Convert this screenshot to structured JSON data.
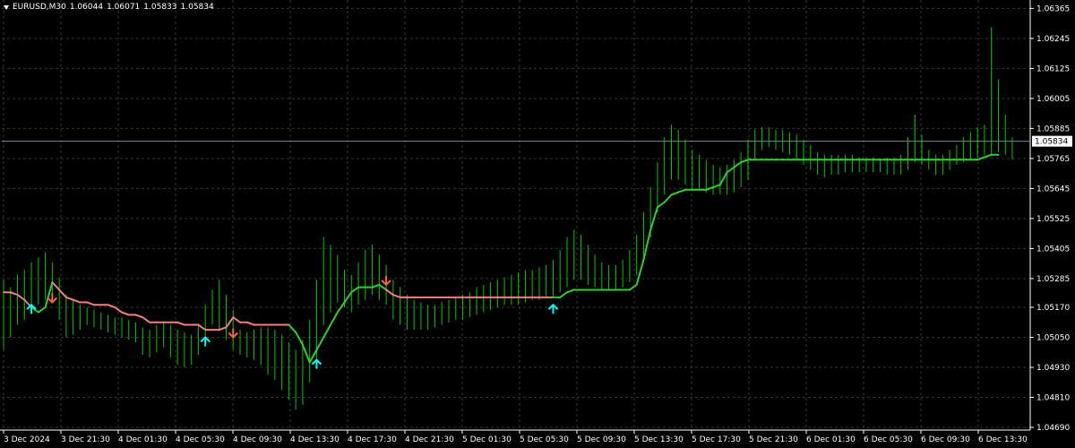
{
  "header": {
    "symbol": "EURUSD,M30",
    "open": "1.06044",
    "high": "1.06071",
    "low": "1.05833",
    "close": "1.05834"
  },
  "colors": {
    "background": "#000000",
    "grid": "#2a3b2a",
    "bars": "#00c800",
    "line_up": "#32cd32",
    "line_down": "#f08080",
    "arrow_up": "#00ffff",
    "arrow_down": "#ff6347",
    "current_price_line": "#778899",
    "axis_text": "#ffffff"
  },
  "chart_data": {
    "type": "line",
    "symbol": "EURUSD",
    "timeframe": "M30",
    "y_ticks": [
      "1.06365",
      "1.06245",
      "1.06125",
      "1.06005",
      "1.05885",
      "1.05765",
      "1.05645",
      "1.05525",
      "1.05405",
      "1.05285",
      "1.05170",
      "1.05050",
      "1.04930",
      "1.04810",
      "1.04690"
    ],
    "ylim": [
      1.0469,
      1.0637
    ],
    "x_ticks": [
      "3 Dec 2024",
      "3 Dec 21:30",
      "4 Dec 01:30",
      "4 Dec 05:30",
      "4 Dec 09:30",
      "4 Dec 13:30",
      "4 Dec 17:30",
      "4 Dec 21:30",
      "5 Dec 01:30",
      "5 Dec 05:30",
      "5 Dec 09:30",
      "5 Dec 13:30",
      "5 Dec 17:30",
      "5 Dec 21:30",
      "6 Dec 01:30",
      "6 Dec 05:30",
      "6 Dec 09:30",
      "6 Dec 13:30"
    ],
    "current_price": "1.05834",
    "bar_count": 142,
    "bars_high_low": [
      [
        1.0528,
        1.05
      ],
      [
        1.0525,
        1.0505
      ],
      [
        1.053,
        1.051
      ],
      [
        1.0532,
        1.0512
      ],
      [
        1.0535,
        1.0515
      ],
      [
        1.0537,
        1.0518
      ],
      [
        1.0539,
        1.052
      ],
      [
        1.0535,
        1.052
      ],
      [
        1.0529,
        1.0512
      ],
      [
        1.0522,
        1.0505
      ],
      [
        1.052,
        1.0506
      ],
      [
        1.0518,
        1.0508
      ],
      [
        1.0517,
        1.051
      ],
      [
        1.0516,
        1.0509
      ],
      [
        1.0515,
        1.0508
      ],
      [
        1.0514,
        1.0507
      ],
      [
        1.0513,
        1.0506
      ],
      [
        1.0513,
        1.0505
      ],
      [
        1.0512,
        1.0504
      ],
      [
        1.0511,
        1.0503
      ],
      [
        1.0509,
        1.0498
      ],
      [
        1.0508,
        1.0497
      ],
      [
        1.051,
        1.0499
      ],
      [
        1.0511,
        1.0501
      ],
      [
        1.051,
        1.0497
      ],
      [
        1.0508,
        1.0494
      ],
      [
        1.0507,
        1.0493
      ],
      [
        1.0506,
        1.0494
      ],
      [
        1.051,
        1.0498
      ],
      [
        1.0518,
        1.0504
      ],
      [
        1.0524,
        1.051
      ],
      [
        1.0528,
        1.0508
      ],
      [
        1.0522,
        1.0504
      ],
      [
        1.0516,
        1.05
      ],
      [
        1.0508,
        1.0498
      ],
      [
        1.0507,
        1.0497
      ],
      [
        1.0508,
        1.0496
      ],
      [
        1.0509,
        1.0494
      ],
      [
        1.0509,
        1.049
      ],
      [
        1.0508,
        1.0488
      ],
      [
        1.0506,
        1.0484
      ],
      [
        1.0503,
        1.048
      ],
      [
        1.05,
        1.0476
      ],
      [
        1.0504,
        1.0478
      ],
      [
        1.0512,
        1.0487
      ],
      [
        1.0528,
        1.0496
      ],
      [
        1.0545,
        1.051
      ],
      [
        1.0542,
        1.0515
      ],
      [
        1.0538,
        1.0519
      ],
      [
        1.0532,
        1.0517
      ],
      [
        1.053,
        1.0515
      ],
      [
        1.0535,
        1.0518
      ],
      [
        1.054,
        1.052
      ],
      [
        1.0542,
        1.0522
      ],
      [
        1.0538,
        1.052
      ],
      [
        1.0534,
        1.0518
      ],
      [
        1.0528,
        1.0512
      ],
      [
        1.0525,
        1.051
      ],
      [
        1.0522,
        1.0508
      ],
      [
        1.052,
        1.0508
      ],
      [
        1.0519,
        1.0508
      ],
      [
        1.0518,
        1.0508
      ],
      [
        1.0518,
        1.0509
      ],
      [
        1.0519,
        1.051
      ],
      [
        1.052,
        1.0511
      ],
      [
        1.0521,
        1.0512
      ],
      [
        1.0522,
        1.0512
      ],
      [
        1.0523,
        1.0513
      ],
      [
        1.0525,
        1.0514
      ],
      [
        1.0526,
        1.0515
      ],
      [
        1.0527,
        1.0516
      ],
      [
        1.0528,
        1.0517
      ],
      [
        1.0529,
        1.0518
      ],
      [
        1.053,
        1.0518
      ],
      [
        1.0531,
        1.0518
      ],
      [
        1.0532,
        1.0519
      ],
      [
        1.0532,
        1.052
      ],
      [
        1.0533,
        1.052
      ],
      [
        1.0534,
        1.0521
      ],
      [
        1.0536,
        1.0521
      ],
      [
        1.054,
        1.0523
      ],
      [
        1.0545,
        1.0525
      ],
      [
        1.0548,
        1.0528
      ],
      [
        1.0546,
        1.0528
      ],
      [
        1.0542,
        1.0526
      ],
      [
        1.0538,
        1.0525
      ],
      [
        1.0535,
        1.0524
      ],
      [
        1.0534,
        1.0524
      ],
      [
        1.0534,
        1.0524
      ],
      [
        1.0536,
        1.0525
      ],
      [
        1.054,
        1.0527
      ],
      [
        1.0546,
        1.053
      ],
      [
        1.0555,
        1.0535
      ],
      [
        1.0565,
        1.0545
      ],
      [
        1.0575,
        1.0555
      ],
      [
        1.0585,
        1.0562
      ],
      [
        1.059,
        1.0568
      ],
      [
        1.0588,
        1.0568
      ],
      [
        1.0584,
        1.0566
      ],
      [
        1.058,
        1.0564
      ],
      [
        1.0578,
        1.0564
      ],
      [
        1.0576,
        1.0563
      ],
      [
        1.0574,
        1.0562
      ],
      [
        1.0573,
        1.0562
      ],
      [
        1.0574,
        1.0562
      ],
      [
        1.0576,
        1.0563
      ],
      [
        1.0579,
        1.0565
      ],
      [
        1.0584,
        1.0568
      ],
      [
        1.0588,
        1.0576
      ],
      [
        1.0589,
        1.058
      ],
      [
        1.0589,
        1.0581
      ],
      [
        1.0588,
        1.058
      ],
      [
        1.0588,
        1.0579
      ],
      [
        1.0587,
        1.0578
      ],
      [
        1.0586,
        1.0576
      ],
      [
        1.0584,
        1.0574
      ],
      [
        1.0582,
        1.0572
      ],
      [
        1.0579,
        1.057
      ],
      [
        1.0578,
        1.0569
      ],
      [
        1.0578,
        1.057
      ],
      [
        1.0578,
        1.057
      ],
      [
        1.0578,
        1.0571
      ],
      [
        1.0578,
        1.0571
      ],
      [
        1.0577,
        1.0571
      ],
      [
        1.0577,
        1.0571
      ],
      [
        1.0577,
        1.0571
      ],
      [
        1.0576,
        1.0571
      ],
      [
        1.0577,
        1.057
      ],
      [
        1.0577,
        1.057
      ],
      [
        1.0578,
        1.057
      ],
      [
        1.0585,
        1.0572
      ],
      [
        1.0594,
        1.0575
      ],
      [
        1.0586,
        1.0574
      ],
      [
        1.058,
        1.0572
      ],
      [
        1.0578,
        1.057
      ],
      [
        1.0578,
        1.057
      ],
      [
        1.058,
        1.0572
      ],
      [
        1.0582,
        1.0574
      ],
      [
        1.0585,
        1.0575
      ],
      [
        1.0587,
        1.0576
      ],
      [
        1.0589,
        1.0577
      ],
      [
        1.059,
        1.0578
      ],
      [
        1.0629,
        1.0578
      ],
      [
        1.0608,
        1.0579
      ],
      [
        1.0594,
        1.0578
      ],
      [
        1.0585,
        1.0576
      ]
    ],
    "indicator_line": [
      1.0523,
      1.0523,
      1.0522,
      1.052,
      1.0517,
      1.0515,
      1.0517,
      1.0527,
      1.0524,
      1.0521,
      1.052,
      1.0519,
      1.0519,
      1.0518,
      1.0518,
      1.0518,
      1.0517,
      1.0515,
      1.0514,
      1.0514,
      1.0513,
      1.0511,
      1.0511,
      1.0511,
      1.0511,
      1.0511,
      1.051,
      1.051,
      1.051,
      1.0508,
      1.0508,
      1.0508,
      1.0509,
      1.0513,
      1.0511,
      1.0511,
      1.051,
      1.051,
      1.051,
      1.051,
      1.051,
      1.051,
      1.0507,
      1.0502,
      1.0495,
      1.05,
      1.0505,
      1.051,
      1.0515,
      1.0519,
      1.0523,
      1.0525,
      1.0525,
      1.0525,
      1.0526,
      1.0524,
      1.0522,
      1.0521,
      1.0521,
      1.0521,
      1.0521,
      1.0521,
      1.0521,
      1.0521,
      1.0521,
      1.0521,
      1.0521,
      1.0521,
      1.0521,
      1.0521,
      1.0521,
      1.0521,
      1.0521,
      1.0521,
      1.0521,
      1.0521,
      1.0521,
      1.0521,
      1.0521,
      1.0521,
      1.0521,
      1.0523,
      1.0524,
      1.0524,
      1.0524,
      1.0524,
      1.0524,
      1.0524,
      1.0524,
      1.0524,
      1.0524,
      1.0526,
      1.0536,
      1.0548,
      1.0557,
      1.0559,
      1.0562,
      1.0563,
      1.0564,
      1.0564,
      1.0564,
      1.0564,
      1.0565,
      1.0566,
      1.0571,
      1.0573,
      1.0575,
      1.0576,
      1.0576,
      1.0576,
      1.0576,
      1.0576,
      1.0576,
      1.0576,
      1.0576,
      1.0576,
      1.0576,
      1.0576,
      1.0576,
      1.0576,
      1.0576,
      1.0576,
      1.0576,
      1.0576,
      1.0576,
      1.0576,
      1.0576,
      1.0576,
      1.0576,
      1.0576,
      1.0576,
      1.0576,
      1.0576,
      1.0576,
      1.0576,
      1.0576,
      1.0576,
      1.0576,
      1.0576,
      1.0576,
      1.0576,
      1.0577,
      1.0578,
      1.0578
    ],
    "line_down_ranges": [
      [
        0,
        4
      ],
      [
        7,
        41
      ],
      [
        55,
        79
      ]
    ],
    "arrows": [
      {
        "bar": 4,
        "dir": "up",
        "price": 1.0518
      },
      {
        "bar": 7,
        "dir": "down",
        "price": 1.0519
      },
      {
        "bar": 29,
        "dir": "up",
        "price": 1.0505
      },
      {
        "bar": 33,
        "dir": "down",
        "price": 1.0505
      },
      {
        "bar": 45,
        "dir": "up",
        "price": 1.0496
      },
      {
        "bar": 55,
        "dir": "down",
        "price": 1.0526
      },
      {
        "bar": 79,
        "dir": "up",
        "price": 1.0518
      }
    ]
  }
}
